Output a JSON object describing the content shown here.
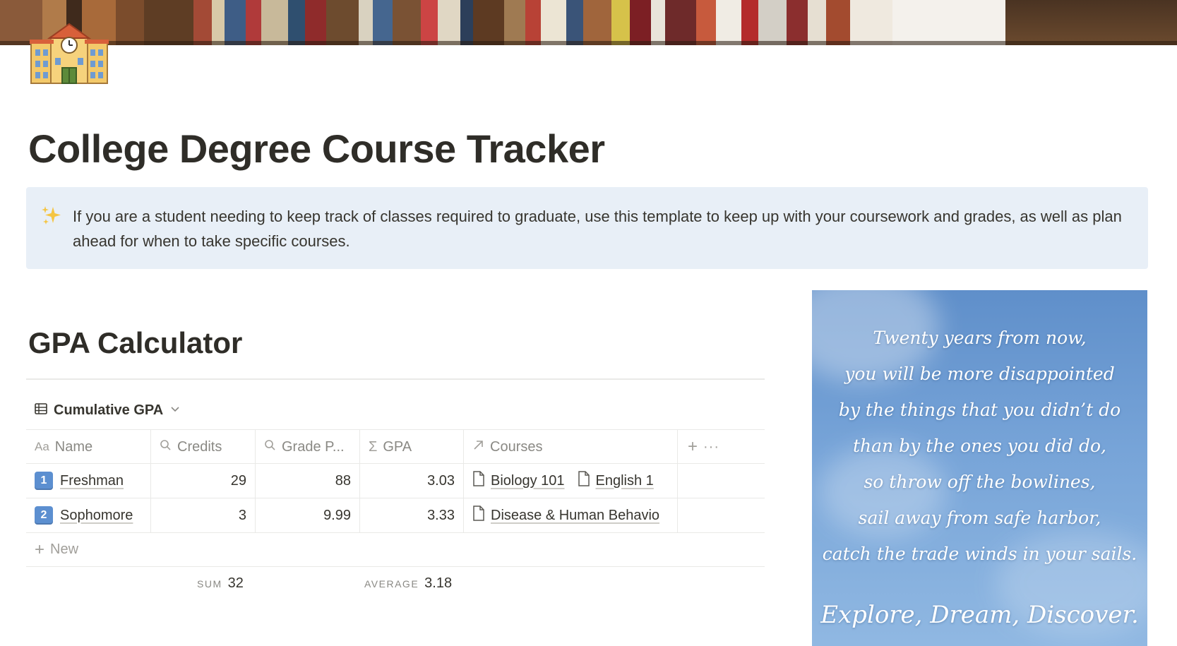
{
  "page": {
    "title": "College Degree Course Tracker",
    "icon": "school-building-icon"
  },
  "callout": {
    "icon": "sparkles-icon",
    "text": "If you are a student needing to keep track of classes required to graduate, use this template to keep up with your coursework and grades, as well as plan ahead for when to take specific courses."
  },
  "section": {
    "heading": "GPA Calculator"
  },
  "view": {
    "name": "Cumulative GPA"
  },
  "table": {
    "columns": {
      "name": "Name",
      "credits": "Credits",
      "grade": "Grade P...",
      "gpa": "GPA",
      "courses": "Courses"
    },
    "rows": [
      {
        "badge": "1",
        "name": "Freshman",
        "credits": "29",
        "grade": "88",
        "gpa": "3.03",
        "courses": [
          "Biology 101",
          "English 1"
        ]
      },
      {
        "badge": "2",
        "name": "Sophomore",
        "credits": "3",
        "grade": "9.99",
        "gpa": "3.33",
        "courses": [
          "Disease & Human Behavio"
        ]
      }
    ],
    "new_label": "New",
    "calc": {
      "sum_label": "SUM",
      "sum_value": "32",
      "avg_label": "AVERAGE",
      "avg_value": "3.18"
    }
  },
  "quote": {
    "lines": [
      "Twenty years from now,",
      "you will be more disappointed",
      "by the things that you didn’t do",
      "than by the ones you did do,",
      "so throw off the bowlines,",
      "sail away from safe harbor,",
      "catch the trade winds in your sails."
    ],
    "tagline": "Explore, Dream, Discover."
  }
}
